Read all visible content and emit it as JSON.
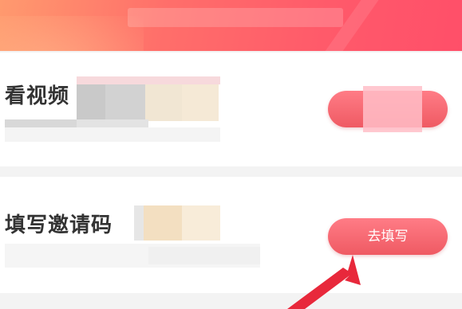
{
  "header": {
    "title_obscured": true
  },
  "tasks": [
    {
      "label": "看视频",
      "button_label": "",
      "button_obscured": true
    },
    {
      "label": "填写邀请码",
      "button_label": "去填写",
      "button_obscured": false
    }
  ],
  "colors": {
    "header_gradient_start": "#ff9a6e",
    "header_gradient_end": "#ff4f69",
    "button_color": "#ef5a63",
    "label_color": "#333333",
    "arrow_color": "#e8283b"
  }
}
